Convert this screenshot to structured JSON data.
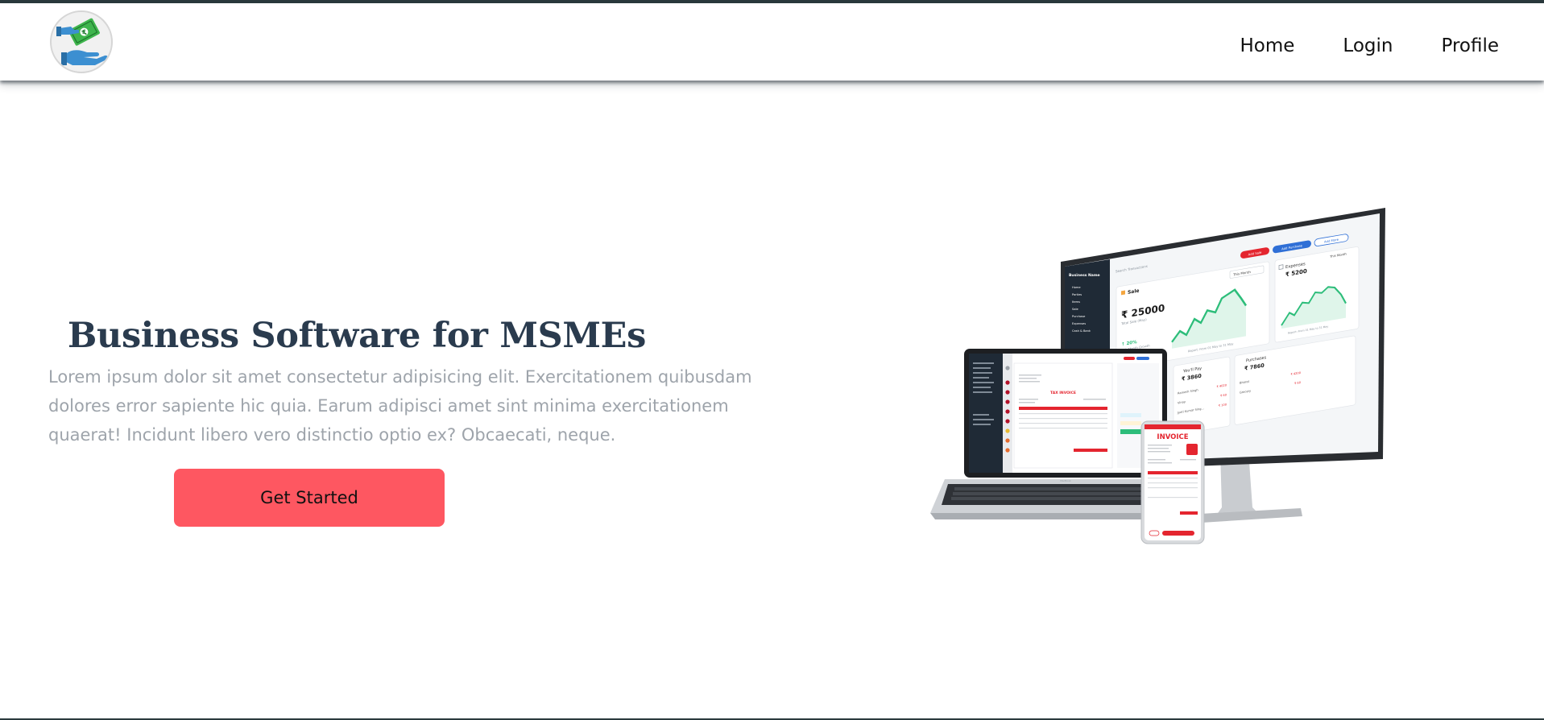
{
  "nav": {
    "logo_name": "hand-money-logo",
    "links": [
      "Home",
      "Login",
      "Profile"
    ]
  },
  "hero": {
    "title": "Business Software for MSMEs",
    "description": "Lorem ipsum dolor sit amet consectetur adipisicing elit. Exercitationem quibusdam dolores error sapiente hic quia. Earum adipisci amet sint minima exercitationem quaerat! Incidunt libero vero distinctio optio ex? Obcaecati, neque.",
    "cta_label": "Get Started"
  },
  "illustration": {
    "monitor": {
      "sale_label": "Sale",
      "sale_value": "₹ 25000",
      "sale_caption": "Total Sale (May)",
      "growth": "↑ 20%",
      "growth_caption": "This Month Growth",
      "period": "This Month",
      "report_caption": "Report: From 01 May to 31 May",
      "expenses_label": "Expenses",
      "expenses_value": "₹ 5200",
      "expenses_period": "This Month",
      "expenses_caption": "Report: From 01 May to 31 May",
      "pay_label": "You'll Pay",
      "pay_value": "₹ 3860",
      "pay_rows": [
        "Ramesh Singh",
        "Vinay",
        "Jyoti Kumar Sing..."
      ],
      "pay_amounts": [
        "₹ 4020",
        "₹ 60",
        "₹ 100"
      ],
      "purchases_label": "Purchases",
      "purchases_value": "₹ 7860",
      "purchase_rows": [
        "Bharat",
        "Grocery"
      ],
      "purchase_amounts": [
        "₹ 4200",
        "₹ 60"
      ],
      "buttons": [
        "Add Sale",
        "Add Purchase",
        "Add More"
      ],
      "search_placeholder": "Search Transactions",
      "business_name": "Business Name",
      "menu": [
        "Home",
        "Parties",
        "Items",
        "Sale",
        "Purchase",
        "Expenses",
        "Cash & Bank"
      ],
      "receive_amounts": [
        "₹ 4050",
        "₹ 60"
      ]
    },
    "laptop": {
      "invoice_title": "TAX INVOICE",
      "brand": "MacBook"
    },
    "phone": {
      "invoice_title": "INVOICE"
    }
  },
  "colors": {
    "accent": "#fe5761",
    "title": "#2a3b4e",
    "body_text": "#9ea4ab",
    "topline": "#2b3a3d",
    "chart_green": "#2dbd7a",
    "brand_red": "#e4252f"
  }
}
